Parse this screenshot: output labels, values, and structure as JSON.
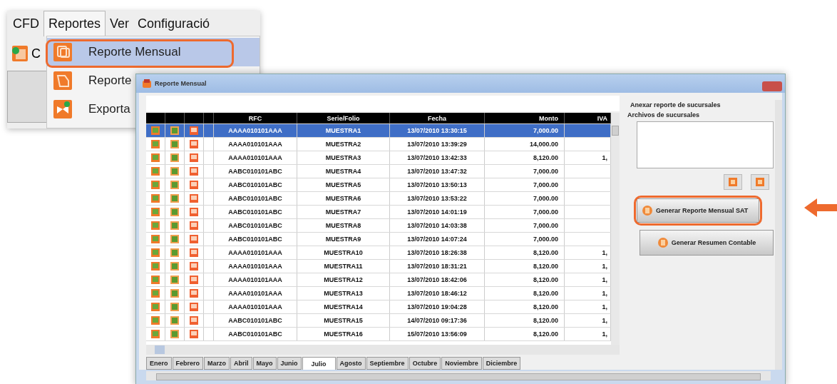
{
  "menu_window": {
    "menu_bar": [
      {
        "label": "CFD",
        "selected": false
      },
      {
        "label": "Reportes",
        "selected": true
      },
      {
        "label": "Ver",
        "selected": false
      },
      {
        "label": "Configuració",
        "selected": false
      }
    ],
    "toolbar_text": "C",
    "dropdown": [
      {
        "label": "Reporte Mensual",
        "selected": true,
        "annotated": true
      },
      {
        "label": "Reporte",
        "selected": false,
        "annotated": false
      },
      {
        "label": "Exporta",
        "selected": false,
        "annotated": false
      }
    ]
  },
  "dialog": {
    "title": "Reporte Mensual",
    "table": {
      "columns": [
        "RFC",
        "Serie/Folio",
        "Fecha",
        "Monto",
        "IVA"
      ],
      "rows": [
        {
          "rfc": "AAAA010101AAA",
          "serie": "MUESTRA1",
          "fecha": "13/07/2010 13:30:15",
          "monto": "7,000.00",
          "selected": true
        },
        {
          "rfc": "AAAA010101AAA",
          "serie": "MUESTRA2",
          "fecha": "13/07/2010 13:39:29",
          "monto": "14,000.00",
          "selected": false
        },
        {
          "rfc": "AAAA010101AAA",
          "serie": "MUESTRA3",
          "fecha": "13/07/2010 13:42:33",
          "monto": "8,120.00",
          "iva": "1,",
          "selected": false
        },
        {
          "rfc": "AABC010101ABC",
          "serie": "MUESTRA4",
          "fecha": "13/07/2010 13:47:32",
          "monto": "7,000.00",
          "selected": false
        },
        {
          "rfc": "AABC010101ABC",
          "serie": "MUESTRA5",
          "fecha": "13/07/2010 13:50:13",
          "monto": "7,000.00",
          "selected": false
        },
        {
          "rfc": "AABC010101ABC",
          "serie": "MUESTRA6",
          "fecha": "13/07/2010 13:53:22",
          "monto": "7,000.00",
          "selected": false
        },
        {
          "rfc": "AABC010101ABC",
          "serie": "MUESTRA7",
          "fecha": "13/07/2010 14:01:19",
          "monto": "7,000.00",
          "selected": false
        },
        {
          "rfc": "AABC010101ABC",
          "serie": "MUESTRA8",
          "fecha": "13/07/2010 14:03:38",
          "monto": "7,000.00",
          "selected": false
        },
        {
          "rfc": "AABC010101ABC",
          "serie": "MUESTRA9",
          "fecha": "13/07/2010 14:07:24",
          "monto": "7,000.00",
          "selected": false
        },
        {
          "rfc": "AAAA010101AAA",
          "serie": "MUESTRA10",
          "fecha": "13/07/2010 18:26:38",
          "monto": "8,120.00",
          "iva": "1,",
          "selected": false
        },
        {
          "rfc": "AAAA010101AAA",
          "serie": "MUESTRA11",
          "fecha": "13/07/2010 18:31:21",
          "monto": "8,120.00",
          "iva": "1,",
          "selected": false
        },
        {
          "rfc": "AAAA010101AAA",
          "serie": "MUESTRA12",
          "fecha": "13/07/2010 18:42:06",
          "monto": "8,120.00",
          "iva": "1,",
          "selected": false
        },
        {
          "rfc": "AAAA010101AAA",
          "serie": "MUESTRA13",
          "fecha": "13/07/2010 18:46:12",
          "monto": "8,120.00",
          "iva": "1,",
          "selected": false
        },
        {
          "rfc": "AAAA010101AAA",
          "serie": "MUESTRA14",
          "fecha": "13/07/2010 19:04:28",
          "monto": "8,120.00",
          "iva": "1,",
          "selected": false
        },
        {
          "rfc": "AABC010101ABC",
          "serie": "MUESTRA15",
          "fecha": "14/07/2010 09:17:36",
          "monto": "8,120.00",
          "iva": "1,",
          "selected": false
        },
        {
          "rfc": "AABC010101ABC",
          "serie": "MUESTRA16",
          "fecha": "15/07/2010 13:56:09",
          "monto": "8,120.00",
          "iva": "1,",
          "selected": false
        }
      ]
    },
    "month_tabs": [
      {
        "label": "Enero",
        "selected": false
      },
      {
        "label": "Febrero",
        "selected": false
      },
      {
        "label": "Marzo",
        "selected": false
      },
      {
        "label": "Abril",
        "selected": false
      },
      {
        "label": "Mayo",
        "selected": false
      },
      {
        "label": "Junio",
        "selected": false
      },
      {
        "label": "Julio",
        "selected": true
      },
      {
        "label": "Agosto",
        "selected": false
      },
      {
        "label": "Septiembre",
        "selected": false
      },
      {
        "label": "Octubre",
        "selected": false
      },
      {
        "label": "Noviembre",
        "selected": false
      },
      {
        "label": "Diciembre",
        "selected": false
      }
    ],
    "side_panel": {
      "heading": "Anexar reporte de sucursales",
      "list_label": "Archivos de sucursales",
      "buttons": [
        {
          "label": "Generar Reporte Mensual SAT",
          "annotated": true
        },
        {
          "label": "Generar Resumen Contable",
          "annotated": false
        }
      ]
    }
  }
}
